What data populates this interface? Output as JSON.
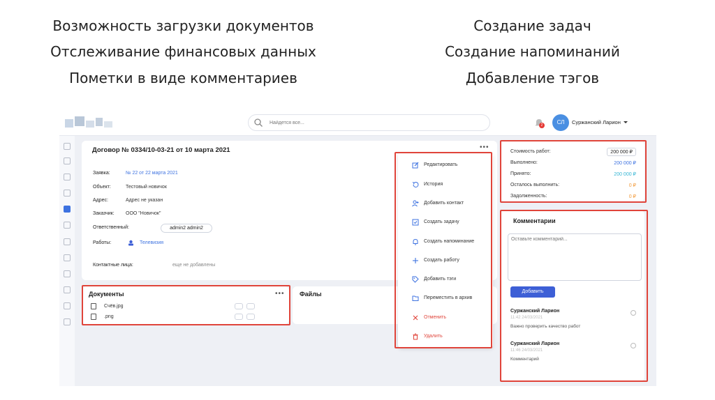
{
  "captions": {
    "left": [
      "Возможность загрузки документов",
      "Отслеживание финансовых данных",
      "Пометки в виде комментариев"
    ],
    "right": [
      "Создание задач",
      "Создание напоминаний",
      "Добавление тэгов"
    ]
  },
  "topbar": {
    "search_placeholder": "Найдется все...",
    "notification_count": "2",
    "avatar_initials": "СЛ",
    "user_name": "Суржанский Ларион"
  },
  "contract": {
    "title": "Договор № 0334/10-03-21 от 10 марта 2021",
    "fields": [
      {
        "label": "Заявка:",
        "value": "№ 22 от 22 марта 2021"
      },
      {
        "label": "Объект:",
        "value": "Тестовый новичок"
      },
      {
        "label": "Адрес:",
        "value": "Адрес не указан"
      },
      {
        "label": "Заказчик:",
        "value": "ООО \"Новичок\""
      }
    ],
    "responsible_label": "Ответственный:",
    "responsible_value": "admin2 admin2",
    "works_label": "Работы:",
    "works_value": "Телевизия",
    "contacts_label": "Контактные лица:",
    "contacts_value": "еще не добавлены"
  },
  "documents": {
    "title": "Документы",
    "files": [
      {
        "name": "Счёв.jpg"
      },
      {
        "name": ".png"
      }
    ]
  },
  "files_card": {
    "title": "Файлы"
  },
  "menu": {
    "items": [
      {
        "label": "Редактировать",
        "icon": "edit-icon"
      },
      {
        "label": "История",
        "icon": "history-icon"
      },
      {
        "label": "Добавить контакт",
        "icon": "add-contact-icon"
      },
      {
        "label": "Создать задачу",
        "icon": "task-icon"
      },
      {
        "label": "Создать напоминание",
        "icon": "bell-icon"
      },
      {
        "label": "Создать работу",
        "icon": "plus-icon"
      },
      {
        "label": "Добавить тэги",
        "icon": "tag-icon"
      },
      {
        "label": "Переместить в архив",
        "icon": "folder-icon"
      },
      {
        "label": "Отменить",
        "icon": "close-icon"
      },
      {
        "label": "Удалить",
        "icon": "trash-icon"
      }
    ]
  },
  "finance": {
    "rows": [
      {
        "label": "Стоимость работ:",
        "value": "200 000 ₽"
      },
      {
        "label": "Выполнено:",
        "value": "200 000 ₽"
      },
      {
        "label": "Принято:",
        "value": "200 000 ₽"
      },
      {
        "label": "Осталось выполнить:",
        "value": "0 ₽"
      },
      {
        "label": "Задолженность:",
        "value": "0 ₽"
      }
    ],
    "colors": {
      "blue": "#3d72e0",
      "teal": "#35b5d4",
      "orange": "#f29a3a"
    }
  },
  "comments": {
    "title": "Комментарии",
    "placeholder": "Оставьте комментарий...",
    "add_button": "Добавить",
    "items": [
      {
        "author": "Суржанский Ларион",
        "date": "11:42 24/03/2021",
        "text": "Важно проверить качество работ"
      },
      {
        "author": "Суржанский Ларион",
        "date": "11:46 24/03/2021",
        "text": "Комментарий"
      }
    ]
  },
  "accent_color": "#3d72e0",
  "highlight_color": "#e0443a"
}
